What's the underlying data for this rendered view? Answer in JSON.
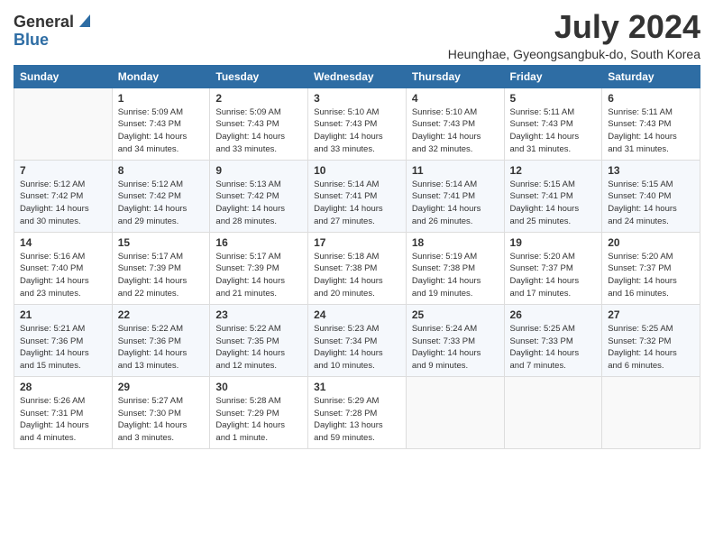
{
  "header": {
    "logo_general": "General",
    "logo_blue": "Blue",
    "month": "July 2024",
    "location": "Heunghae, Gyeongsangbuk-do, South Korea"
  },
  "weekdays": [
    "Sunday",
    "Monday",
    "Tuesday",
    "Wednesday",
    "Thursday",
    "Friday",
    "Saturday"
  ],
  "weeks": [
    [
      {
        "num": "",
        "info": ""
      },
      {
        "num": "1",
        "info": "Sunrise: 5:09 AM\nSunset: 7:43 PM\nDaylight: 14 hours\nand 34 minutes."
      },
      {
        "num": "2",
        "info": "Sunrise: 5:09 AM\nSunset: 7:43 PM\nDaylight: 14 hours\nand 33 minutes."
      },
      {
        "num": "3",
        "info": "Sunrise: 5:10 AM\nSunset: 7:43 PM\nDaylight: 14 hours\nand 33 minutes."
      },
      {
        "num": "4",
        "info": "Sunrise: 5:10 AM\nSunset: 7:43 PM\nDaylight: 14 hours\nand 32 minutes."
      },
      {
        "num": "5",
        "info": "Sunrise: 5:11 AM\nSunset: 7:43 PM\nDaylight: 14 hours\nand 31 minutes."
      },
      {
        "num": "6",
        "info": "Sunrise: 5:11 AM\nSunset: 7:43 PM\nDaylight: 14 hours\nand 31 minutes."
      }
    ],
    [
      {
        "num": "7",
        "info": "Sunrise: 5:12 AM\nSunset: 7:42 PM\nDaylight: 14 hours\nand 30 minutes."
      },
      {
        "num": "8",
        "info": "Sunrise: 5:12 AM\nSunset: 7:42 PM\nDaylight: 14 hours\nand 29 minutes."
      },
      {
        "num": "9",
        "info": "Sunrise: 5:13 AM\nSunset: 7:42 PM\nDaylight: 14 hours\nand 28 minutes."
      },
      {
        "num": "10",
        "info": "Sunrise: 5:14 AM\nSunset: 7:41 PM\nDaylight: 14 hours\nand 27 minutes."
      },
      {
        "num": "11",
        "info": "Sunrise: 5:14 AM\nSunset: 7:41 PM\nDaylight: 14 hours\nand 26 minutes."
      },
      {
        "num": "12",
        "info": "Sunrise: 5:15 AM\nSunset: 7:41 PM\nDaylight: 14 hours\nand 25 minutes."
      },
      {
        "num": "13",
        "info": "Sunrise: 5:15 AM\nSunset: 7:40 PM\nDaylight: 14 hours\nand 24 minutes."
      }
    ],
    [
      {
        "num": "14",
        "info": "Sunrise: 5:16 AM\nSunset: 7:40 PM\nDaylight: 14 hours\nand 23 minutes."
      },
      {
        "num": "15",
        "info": "Sunrise: 5:17 AM\nSunset: 7:39 PM\nDaylight: 14 hours\nand 22 minutes."
      },
      {
        "num": "16",
        "info": "Sunrise: 5:17 AM\nSunset: 7:39 PM\nDaylight: 14 hours\nand 21 minutes."
      },
      {
        "num": "17",
        "info": "Sunrise: 5:18 AM\nSunset: 7:38 PM\nDaylight: 14 hours\nand 20 minutes."
      },
      {
        "num": "18",
        "info": "Sunrise: 5:19 AM\nSunset: 7:38 PM\nDaylight: 14 hours\nand 19 minutes."
      },
      {
        "num": "19",
        "info": "Sunrise: 5:20 AM\nSunset: 7:37 PM\nDaylight: 14 hours\nand 17 minutes."
      },
      {
        "num": "20",
        "info": "Sunrise: 5:20 AM\nSunset: 7:37 PM\nDaylight: 14 hours\nand 16 minutes."
      }
    ],
    [
      {
        "num": "21",
        "info": "Sunrise: 5:21 AM\nSunset: 7:36 PM\nDaylight: 14 hours\nand 15 minutes."
      },
      {
        "num": "22",
        "info": "Sunrise: 5:22 AM\nSunset: 7:36 PM\nDaylight: 14 hours\nand 13 minutes."
      },
      {
        "num": "23",
        "info": "Sunrise: 5:22 AM\nSunset: 7:35 PM\nDaylight: 14 hours\nand 12 minutes."
      },
      {
        "num": "24",
        "info": "Sunrise: 5:23 AM\nSunset: 7:34 PM\nDaylight: 14 hours\nand 10 minutes."
      },
      {
        "num": "25",
        "info": "Sunrise: 5:24 AM\nSunset: 7:33 PM\nDaylight: 14 hours\nand 9 minutes."
      },
      {
        "num": "26",
        "info": "Sunrise: 5:25 AM\nSunset: 7:33 PM\nDaylight: 14 hours\nand 7 minutes."
      },
      {
        "num": "27",
        "info": "Sunrise: 5:25 AM\nSunset: 7:32 PM\nDaylight: 14 hours\nand 6 minutes."
      }
    ],
    [
      {
        "num": "28",
        "info": "Sunrise: 5:26 AM\nSunset: 7:31 PM\nDaylight: 14 hours\nand 4 minutes."
      },
      {
        "num": "29",
        "info": "Sunrise: 5:27 AM\nSunset: 7:30 PM\nDaylight: 14 hours\nand 3 minutes."
      },
      {
        "num": "30",
        "info": "Sunrise: 5:28 AM\nSunset: 7:29 PM\nDaylight: 14 hours\nand 1 minute."
      },
      {
        "num": "31",
        "info": "Sunrise: 5:29 AM\nSunset: 7:28 PM\nDaylight: 13 hours\nand 59 minutes."
      },
      {
        "num": "",
        "info": ""
      },
      {
        "num": "",
        "info": ""
      },
      {
        "num": "",
        "info": ""
      }
    ]
  ]
}
